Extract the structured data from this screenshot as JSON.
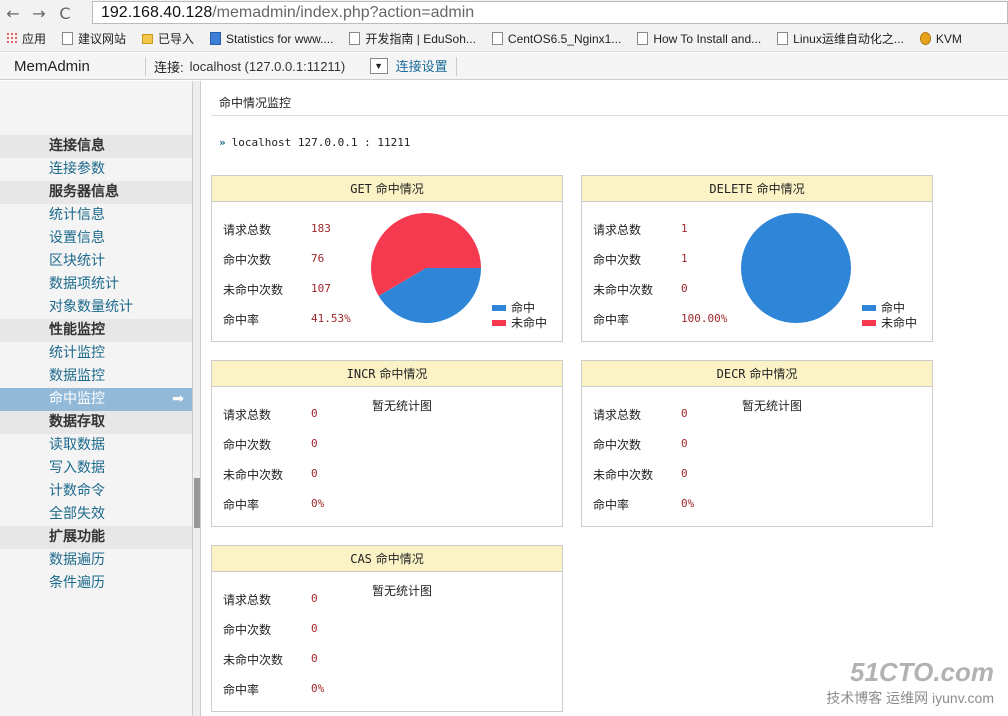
{
  "browser": {
    "url_host": "192.168.40.128",
    "url_path": "/memadmin/index.php?action=admin",
    "bookmarks": [
      {
        "label": "应用",
        "icon": "apps"
      },
      {
        "label": "建议网站",
        "icon": "page"
      },
      {
        "label": "已导入",
        "icon": "folder"
      },
      {
        "label": "Statistics for www....",
        "icon": "blue"
      },
      {
        "label": "开发指南 | EduSoh...",
        "icon": "page"
      },
      {
        "label": "CentOS6.5_Nginx1...",
        "icon": "page"
      },
      {
        "label": "How To Install and...",
        "icon": "page"
      },
      {
        "label": "Linux运维自动化之...",
        "icon": "page"
      },
      {
        "label": "KVM",
        "icon": "kvm"
      }
    ]
  },
  "header": {
    "brand": "MemAdmin",
    "conn_label": "连接:",
    "conn_value": "localhost (127.0.0.1:11211)",
    "conn_settings": "连接设置"
  },
  "sidebar": {
    "items": [
      {
        "type": "group",
        "label": "连接信息"
      },
      {
        "type": "item",
        "label": "连接参数"
      },
      {
        "type": "group",
        "label": "服务器信息"
      },
      {
        "type": "item",
        "label": "统计信息"
      },
      {
        "type": "item",
        "label": "设置信息"
      },
      {
        "type": "item",
        "label": "区块统计"
      },
      {
        "type": "item",
        "label": "数据项统计"
      },
      {
        "type": "item",
        "label": "对象数量统计"
      },
      {
        "type": "group",
        "label": "性能监控"
      },
      {
        "type": "item",
        "label": "统计监控"
      },
      {
        "type": "item",
        "label": "数据监控"
      },
      {
        "type": "item",
        "label": "命中监控",
        "active": true
      },
      {
        "type": "group",
        "label": "数据存取"
      },
      {
        "type": "item",
        "label": "读取数据"
      },
      {
        "type": "item",
        "label": "写入数据"
      },
      {
        "type": "item",
        "label": "计数命令"
      },
      {
        "type": "item",
        "label": "全部失效"
      },
      {
        "type": "group",
        "label": "扩展功能"
      },
      {
        "type": "item",
        "label": "数据遍历"
      },
      {
        "type": "item",
        "label": "条件遍历"
      }
    ]
  },
  "main": {
    "title": "命中情况监控",
    "server": "localhost  127.0.0.1 : 11211",
    "labels": [
      "请求总数",
      "命中次数",
      "未命中次数",
      "命中率"
    ],
    "legend": {
      "hit": "命中",
      "miss": "未命中"
    },
    "colors": {
      "hit": "#2f86d8",
      "miss": "#f53a50"
    },
    "no_chart": "暂无统计图",
    "panels": [
      {
        "cmd": "GET",
        "title": "命中情况",
        "values": [
          "183",
          "76",
          "107",
          "41.53%"
        ],
        "chart": true,
        "hit_pct": 41.53
      },
      {
        "cmd": "DELETE",
        "title": "命中情况",
        "values": [
          "1",
          "1",
          "0",
          "100.00%"
        ],
        "chart": true,
        "hit_pct": 100
      },
      {
        "cmd": "INCR",
        "title": "命中情况",
        "values": [
          "0",
          "0",
          "0",
          "0%"
        ],
        "chart": false
      },
      {
        "cmd": "DECR",
        "title": "命中情况",
        "values": [
          "0",
          "0",
          "0",
          "0%"
        ],
        "chart": false
      },
      {
        "cmd": "CAS",
        "title": "命中情况",
        "values": [
          "0",
          "0",
          "0",
          "0%"
        ],
        "chart": false
      }
    ]
  },
  "watermark": {
    "line1": "51CTO.com",
    "line2": "技术博客 运维网 iyunv.com"
  }
}
